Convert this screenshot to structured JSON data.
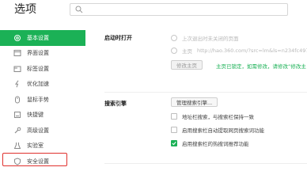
{
  "header": {
    "title": "选项",
    "search_placeholder": ""
  },
  "sidebar": {
    "items": [
      {
        "label": "基本设置",
        "icon": "gear-icon",
        "active": true
      },
      {
        "label": "界面设置",
        "icon": "window-icon"
      },
      {
        "label": "标签设置",
        "icon": "tab-icon"
      },
      {
        "label": "优化加速",
        "icon": "lightning-icon"
      },
      {
        "label": "鼠标手势",
        "icon": "mouse-icon"
      },
      {
        "label": "快捷键",
        "icon": "keyboard-icon"
      },
      {
        "label": "高级设置",
        "icon": "wrench-icon",
        "highlighted": true
      },
      {
        "label": "实验室",
        "icon": "flask-icon"
      },
      {
        "label": "安全设置",
        "icon": "shield-icon"
      }
    ]
  },
  "startup": {
    "label": "启动时打开",
    "option1": "上次退出时未关闭的页面",
    "option2_prefix": "主页",
    "option2_url": "http://hao.360.com/?src=lm&ls=n234fc497",
    "modify_button": "修改主页",
    "locked_hint": "主页已锁定，如需修改，请修改“修改主"
  },
  "search": {
    "label": "搜索引擎",
    "manage_button": "管理搜索引擎...",
    "options": [
      {
        "label": "地址栏搜索，与搜索栏保持一致",
        "checked": false
      },
      {
        "label": "启用搜索栏自动提取网页搜索词功能",
        "checked": false
      },
      {
        "label": "启用搜索栏的热搜词推荐功能",
        "checked": true
      }
    ]
  },
  "colors": {
    "accent": "#1bb156",
    "highlight_border": "#e0312e"
  }
}
